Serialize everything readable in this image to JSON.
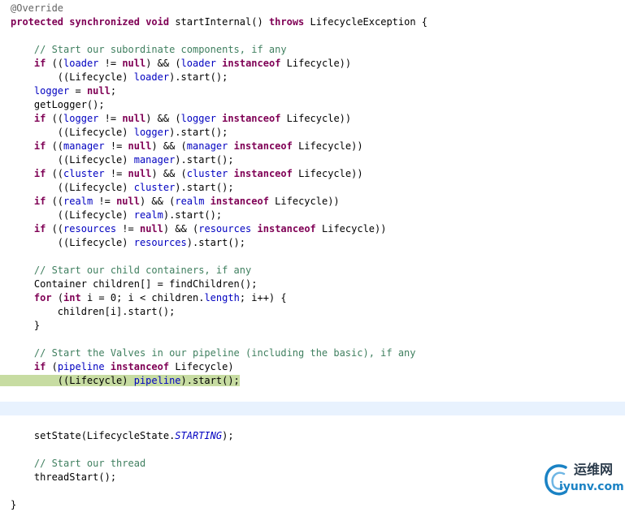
{
  "editor": {
    "highlight_line": 27,
    "current_line": 29,
    "lines": [
      [
        {
          "t": "@Override",
          "c": "ann"
        }
      ],
      [
        {
          "t": "protected",
          "c": "kw"
        },
        {
          "t": " "
        },
        {
          "t": "synchronized",
          "c": "kw"
        },
        {
          "t": " "
        },
        {
          "t": "void",
          "c": "kw"
        },
        {
          "t": " startInternal() "
        },
        {
          "t": "throws",
          "c": "kw"
        },
        {
          "t": " LifecycleException {"
        }
      ],
      [],
      [
        {
          "t": "    "
        },
        {
          "t": "// Start our subordinate components, if any",
          "c": "comment"
        }
      ],
      [
        {
          "t": "    "
        },
        {
          "t": "if",
          "c": "kw"
        },
        {
          "t": " (("
        },
        {
          "t": "loader",
          "c": "field"
        },
        {
          "t": " != "
        },
        {
          "t": "null",
          "c": "kw"
        },
        {
          "t": ") && ("
        },
        {
          "t": "loader",
          "c": "field"
        },
        {
          "t": " "
        },
        {
          "t": "instanceof",
          "c": "kw"
        },
        {
          "t": " Lifecycle))"
        }
      ],
      [
        {
          "t": "        ((Lifecycle) "
        },
        {
          "t": "loader",
          "c": "field"
        },
        {
          "t": ").start();"
        }
      ],
      [
        {
          "t": "    "
        },
        {
          "t": "logger",
          "c": "field"
        },
        {
          "t": " = "
        },
        {
          "t": "null",
          "c": "kw"
        },
        {
          "t": ";"
        }
      ],
      [
        {
          "t": "    getLogger();"
        }
      ],
      [
        {
          "t": "    "
        },
        {
          "t": "if",
          "c": "kw"
        },
        {
          "t": " (("
        },
        {
          "t": "logger",
          "c": "field"
        },
        {
          "t": " != "
        },
        {
          "t": "null",
          "c": "kw"
        },
        {
          "t": ") && ("
        },
        {
          "t": "logger",
          "c": "field"
        },
        {
          "t": " "
        },
        {
          "t": "instanceof",
          "c": "kw"
        },
        {
          "t": " Lifecycle))"
        }
      ],
      [
        {
          "t": "        ((Lifecycle) "
        },
        {
          "t": "logger",
          "c": "field"
        },
        {
          "t": ").start();"
        }
      ],
      [
        {
          "t": "    "
        },
        {
          "t": "if",
          "c": "kw"
        },
        {
          "t": " (("
        },
        {
          "t": "manager",
          "c": "field"
        },
        {
          "t": " != "
        },
        {
          "t": "null",
          "c": "kw"
        },
        {
          "t": ") && ("
        },
        {
          "t": "manager",
          "c": "field"
        },
        {
          "t": " "
        },
        {
          "t": "instanceof",
          "c": "kw"
        },
        {
          "t": " Lifecycle))"
        }
      ],
      [
        {
          "t": "        ((Lifecycle) "
        },
        {
          "t": "manager",
          "c": "field"
        },
        {
          "t": ").start();"
        }
      ],
      [
        {
          "t": "    "
        },
        {
          "t": "if",
          "c": "kw"
        },
        {
          "t": " (("
        },
        {
          "t": "cluster",
          "c": "field"
        },
        {
          "t": " != "
        },
        {
          "t": "null",
          "c": "kw"
        },
        {
          "t": ") && ("
        },
        {
          "t": "cluster",
          "c": "field"
        },
        {
          "t": " "
        },
        {
          "t": "instanceof",
          "c": "kw"
        },
        {
          "t": " Lifecycle))"
        }
      ],
      [
        {
          "t": "        ((Lifecycle) "
        },
        {
          "t": "cluster",
          "c": "field"
        },
        {
          "t": ").start();"
        }
      ],
      [
        {
          "t": "    "
        },
        {
          "t": "if",
          "c": "kw"
        },
        {
          "t": " (("
        },
        {
          "t": "realm",
          "c": "field"
        },
        {
          "t": " != "
        },
        {
          "t": "null",
          "c": "kw"
        },
        {
          "t": ") && ("
        },
        {
          "t": "realm",
          "c": "field"
        },
        {
          "t": " "
        },
        {
          "t": "instanceof",
          "c": "kw"
        },
        {
          "t": " Lifecycle))"
        }
      ],
      [
        {
          "t": "        ((Lifecycle) "
        },
        {
          "t": "realm",
          "c": "field"
        },
        {
          "t": ").start();"
        }
      ],
      [
        {
          "t": "    "
        },
        {
          "t": "if",
          "c": "kw"
        },
        {
          "t": " (("
        },
        {
          "t": "resources",
          "c": "field"
        },
        {
          "t": " != "
        },
        {
          "t": "null",
          "c": "kw"
        },
        {
          "t": ") && ("
        },
        {
          "t": "resources",
          "c": "field"
        },
        {
          "t": " "
        },
        {
          "t": "instanceof",
          "c": "kw"
        },
        {
          "t": " Lifecycle))"
        }
      ],
      [
        {
          "t": "        ((Lifecycle) "
        },
        {
          "t": "resources",
          "c": "field"
        },
        {
          "t": ").start();"
        }
      ],
      [],
      [
        {
          "t": "    "
        },
        {
          "t": "// Start our child containers, if any",
          "c": "comment"
        }
      ],
      [
        {
          "t": "    Container children[] = findChildren();"
        }
      ],
      [
        {
          "t": "    "
        },
        {
          "t": "for",
          "c": "kw"
        },
        {
          "t": " ("
        },
        {
          "t": "int",
          "c": "kw"
        },
        {
          "t": " i = 0; i < children."
        },
        {
          "t": "length",
          "c": "field"
        },
        {
          "t": "; i++) {"
        }
      ],
      [
        {
          "t": "        children[i].start();"
        }
      ],
      [
        {
          "t": "    }"
        }
      ],
      [],
      [
        {
          "t": "    "
        },
        {
          "t": "// Start the Valves in our pipeline (including the basic), if any",
          "c": "comment"
        }
      ],
      [
        {
          "t": "    "
        },
        {
          "t": "if",
          "c": "kw"
        },
        {
          "t": " ("
        },
        {
          "t": "pipeline",
          "c": "field"
        },
        {
          "t": " "
        },
        {
          "t": "instanceof",
          "c": "kw"
        },
        {
          "t": " Lifecycle)"
        }
      ],
      [
        {
          "t": "        ((Lifecycle) "
        },
        {
          "t": "pipeline",
          "c": "field"
        },
        {
          "t": ").start();"
        }
      ],
      [],
      [],
      [],
      [
        {
          "t": "    setState(LifecycleState."
        },
        {
          "t": "STARTING",
          "c": "static"
        },
        {
          "t": ");"
        }
      ],
      [],
      [
        {
          "t": "    "
        },
        {
          "t": "// Start our thread",
          "c": "comment"
        }
      ],
      [
        {
          "t": "    threadStart();"
        }
      ],
      [],
      [
        {
          "t": "}"
        }
      ]
    ]
  },
  "watermark": {
    "cn": "运维网",
    "url": "iyunv.com",
    "color": "#1a82c4"
  }
}
